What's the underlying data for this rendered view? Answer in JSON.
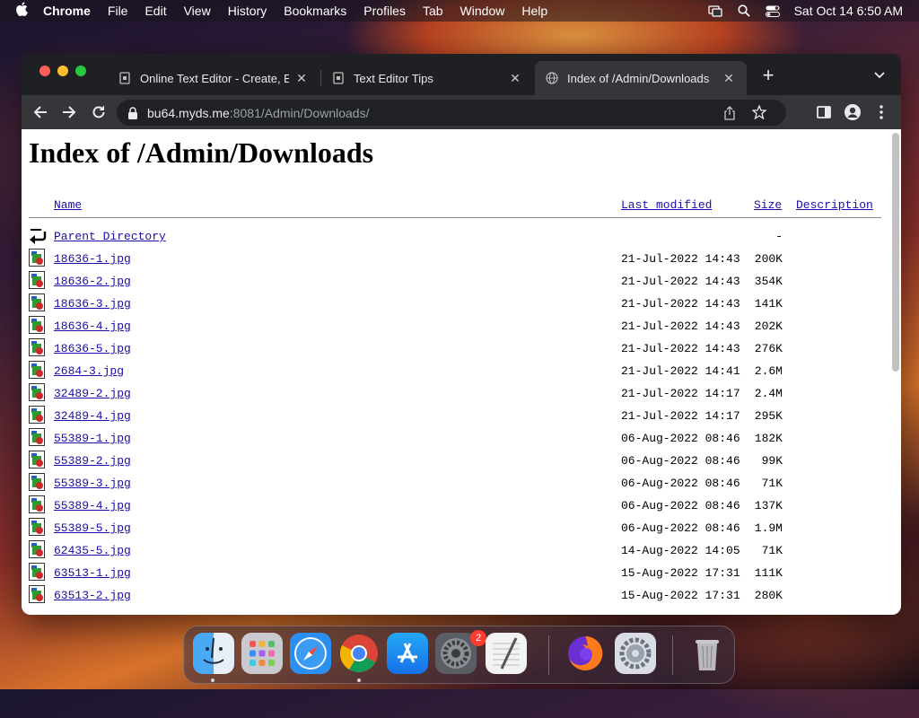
{
  "menubar": {
    "app": "Chrome",
    "items": [
      "File",
      "Edit",
      "View",
      "History",
      "Bookmarks",
      "Profiles",
      "Tab",
      "Window",
      "Help"
    ],
    "clock": "Sat Oct 14  6:50 AM"
  },
  "tabs": [
    {
      "title": "Online Text Editor - Create, Ed",
      "active": false
    },
    {
      "title": "Text Editor Tips",
      "active": false
    },
    {
      "title": "Index of /Admin/Downloads",
      "active": true
    }
  ],
  "address": {
    "host": "bu64.myds.me",
    "rest": ":8081/Admin/Downloads/"
  },
  "page": {
    "heading": "Index of /Admin/Downloads",
    "columns": {
      "name": "Name",
      "modified": "Last modified",
      "size": "Size",
      "description": "Description"
    },
    "parent": {
      "name": "Parent Directory",
      "size": "-"
    },
    "files": [
      {
        "name": "18636-1.jpg",
        "date": "21-Jul-2022 14:43",
        "size": "200K"
      },
      {
        "name": "18636-2.jpg",
        "date": "21-Jul-2022 14:43",
        "size": "354K"
      },
      {
        "name": "18636-3.jpg",
        "date": "21-Jul-2022 14:43",
        "size": "141K"
      },
      {
        "name": "18636-4.jpg",
        "date": "21-Jul-2022 14:43",
        "size": "202K"
      },
      {
        "name": "18636-5.jpg",
        "date": "21-Jul-2022 14:43",
        "size": "276K"
      },
      {
        "name": "2684-3.jpg",
        "date": "21-Jul-2022 14:41",
        "size": "2.6M"
      },
      {
        "name": "32489-2.jpg",
        "date": "21-Jul-2022 14:17",
        "size": "2.4M"
      },
      {
        "name": "32489-4.jpg",
        "date": "21-Jul-2022 14:17",
        "size": "295K"
      },
      {
        "name": "55389-1.jpg",
        "date": "06-Aug-2022 08:46",
        "size": "182K"
      },
      {
        "name": "55389-2.jpg",
        "date": "06-Aug-2022 08:46",
        "size": "99K"
      },
      {
        "name": "55389-3.jpg",
        "date": "06-Aug-2022 08:46",
        "size": "71K"
      },
      {
        "name": "55389-4.jpg",
        "date": "06-Aug-2022 08:46",
        "size": "137K"
      },
      {
        "name": "55389-5.jpg",
        "date": "06-Aug-2022 08:46",
        "size": "1.9M"
      },
      {
        "name": "62435-5.jpg",
        "date": "14-Aug-2022 14:05",
        "size": "71K"
      },
      {
        "name": "63513-1.jpg",
        "date": "15-Aug-2022 17:31",
        "size": "111K"
      },
      {
        "name": "63513-2.jpg",
        "date": "15-Aug-2022 17:31",
        "size": "280K"
      }
    ]
  },
  "dock": {
    "apps": [
      "finder",
      "launchpad",
      "safari",
      "chrome",
      "app-store",
      "system-settings",
      "textedit",
      "firefox",
      "system-preferences",
      "trash"
    ],
    "settings_badge": "2"
  },
  "colors": {
    "link": "#1a0dab",
    "tab_active": "#35363a",
    "window_bg": "#202124"
  }
}
